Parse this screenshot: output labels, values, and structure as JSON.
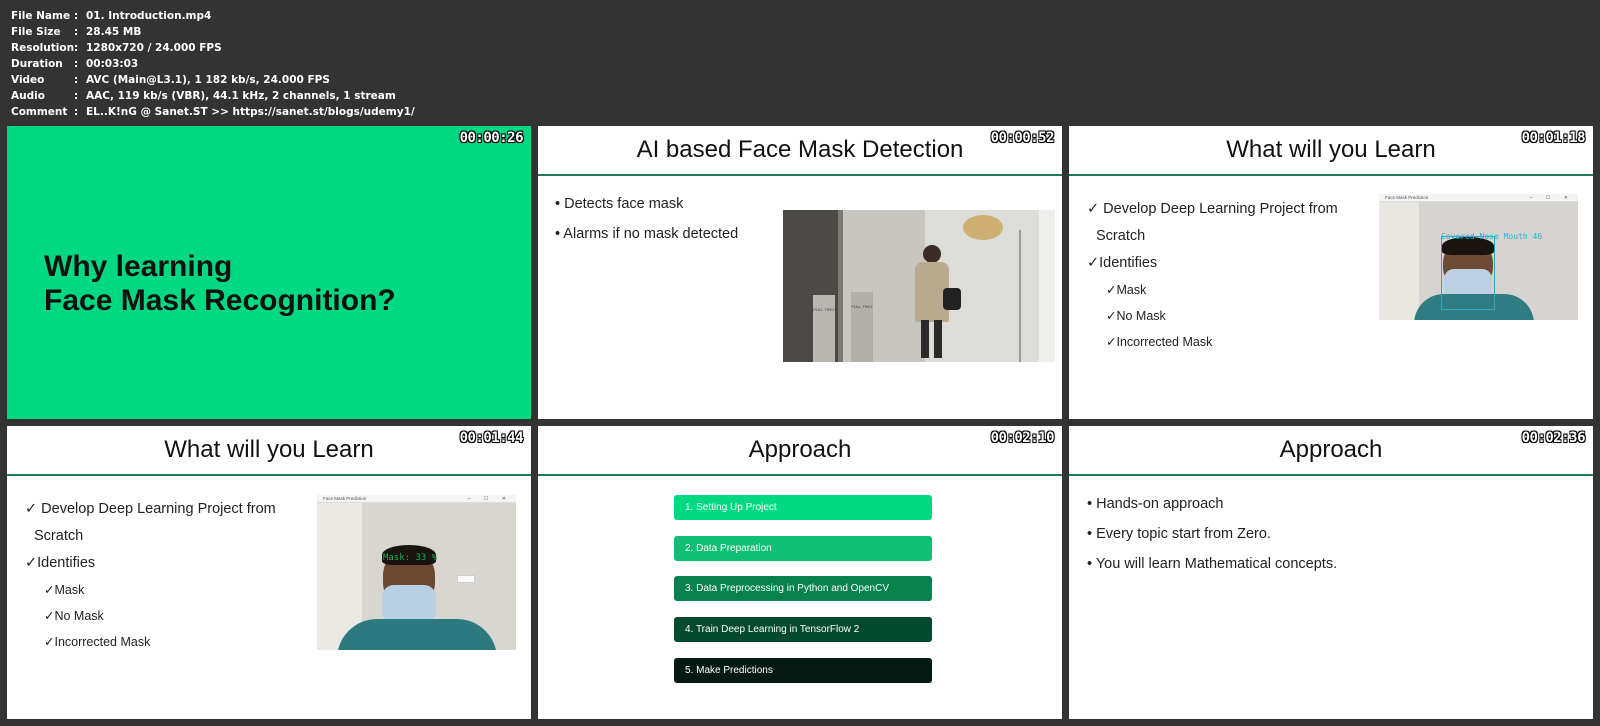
{
  "header": {
    "rows": [
      {
        "key": "File Name",
        "value": "01. Introduction.mp4"
      },
      {
        "key": "File Size",
        "value": "28.45 MB"
      },
      {
        "key": "Resolution",
        "value": "1280x720 / 24.000 FPS"
      },
      {
        "key": "Duration",
        "value": "00:03:03"
      },
      {
        "key": "Video",
        "value": "AVC (Main@L3.1), 1 182 kb/s, 24.000 FPS"
      },
      {
        "key": "Audio",
        "value": "AAC, 119 kb/s (VBR), 44.1 kHz, 2 channels, 1 stream"
      },
      {
        "key": "Comment",
        "value": "EL..K!nG @ Sanet.ST  >> https://sanet.st/blogs/udemy1/"
      }
    ],
    "separator": ":"
  },
  "thumbs": [
    {
      "timestamp": "00:00:26",
      "line1": "Why learning",
      "line2": "Face Mask Recognition?"
    },
    {
      "timestamp": "00:00:52",
      "title": "AI based Face Mask Detection",
      "bullets": [
        "• Detects face mask",
        "• Alarms if no mask detected"
      ]
    },
    {
      "timestamp": "00:01:18",
      "title": "What will you Learn",
      "items": [
        "✓ Develop Deep Learning Project from",
        "Scratch",
        "✓Identifies"
      ],
      "subitems": [
        "✓Mask",
        "✓No Mask",
        "✓Incorrected Mask"
      ],
      "overlay": "Covered Nose Mouth 46"
    },
    {
      "timestamp": "00:01:44",
      "title": "What will you Learn",
      "items": [
        "✓ Develop Deep Learning Project from",
        "Scratch",
        "✓Identifies"
      ],
      "subitems": [
        "✓Mask",
        "✓No Mask",
        "✓Incorrected Mask"
      ],
      "overlay": "Mask: 33 %"
    },
    {
      "timestamp": "00:02:10",
      "title": "Approach",
      "steps": [
        {
          "label": "1. Setting Up Project",
          "color": "#00d882"
        },
        {
          "label": "2. Data Preparation",
          "color": "#0fbf74"
        },
        {
          "label": "3. Data Preprocessing in Python and OpenCV",
          "color": "#07824f"
        },
        {
          "label": "4. Train Deep Learning in TensorFlow 2",
          "color": "#044a2f"
        },
        {
          "label": "5. Make Predictions",
          "color": "#041a12"
        }
      ]
    },
    {
      "timestamp": "00:02:36",
      "title": "Approach",
      "bullets": [
        "• Hands-on approach",
        "• Every topic start from Zero.",
        "• You will learn Mathematical concepts."
      ]
    }
  ],
  "window": {
    "title": "Face Mask Prediction",
    "controls": "– ☐ ✕"
  },
  "door_sign": "PULL TREZ"
}
